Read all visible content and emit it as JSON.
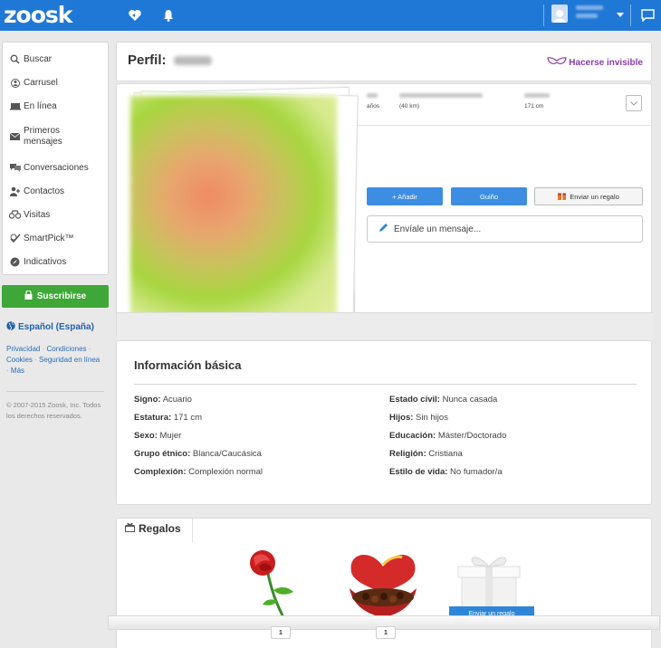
{
  "brand": {
    "logo": "zoosk"
  },
  "header": {
    "icons": [
      "heart-icon",
      "bell-icon",
      "avatar-icon",
      "chevron-down-icon",
      "chat-icon"
    ]
  },
  "sidebar": {
    "items": [
      {
        "label": "Buscar",
        "icon": "search-icon"
      },
      {
        "label": "Carrusel",
        "icon": "carousel-icon"
      },
      {
        "label": "En línea",
        "icon": "online-icon"
      },
      {
        "label": "Primeros mensajes",
        "icon": "envelope-icon"
      },
      {
        "label": "Conversaciones",
        "icon": "conversations-icon"
      },
      {
        "label": "Contactos",
        "icon": "contacts-icon"
      },
      {
        "label": "Visitas",
        "icon": "binoculars-icon"
      },
      {
        "label": "SmartPick™",
        "icon": "smartpick-icon"
      },
      {
        "label": "Indicativos",
        "icon": "compass-icon"
      }
    ],
    "subscribe": "Suscribirse",
    "language": "Español (España)",
    "links": [
      "Privacidad",
      "Condiciones",
      "Cookies",
      "Seguridad en línea",
      "Más"
    ],
    "copyright": "© 2007-2015 Zoosk, Inc. Todos los derechos reservados."
  },
  "profile": {
    "title": "Perfil:",
    "invisible": "Hacerse invisible",
    "stats": {
      "age_unit": "años",
      "distance": "(40 km)",
      "height": "171 cm"
    },
    "buttons": {
      "add": "+ Añadir",
      "wink": "Guiño",
      "gift": "Enviar un regalo"
    },
    "message_placeholder": "Envíale un mensaje..."
  },
  "basic_info": {
    "heading": "Información básica",
    "left": [
      {
        "label": "Signo:",
        "value": "Acuario"
      },
      {
        "label": "Estatura:",
        "value": "171 cm"
      },
      {
        "label": "Sexo:",
        "value": "Mujer"
      },
      {
        "label": "Grupo étnico:",
        "value": "Blanca/Caucásica"
      },
      {
        "label": "Complexión:",
        "value": "Complexión normal"
      }
    ],
    "right": [
      {
        "label": "Estado civil:",
        "value": "Nunca casada"
      },
      {
        "label": "Hijos:",
        "value": "Sin hijos"
      },
      {
        "label": "Educación:",
        "value": "Máster/Doctorado"
      },
      {
        "label": "Religión:",
        "value": "Cristiana"
      },
      {
        "label": "Estilo de vida:",
        "value": "No fumador/a"
      }
    ]
  },
  "gifts": {
    "title": "Regalos",
    "counts": [
      "1",
      "1"
    ],
    "send_label": "Enviar un regalo"
  },
  "colors": {
    "brand_blue": "#1f78d6",
    "subscribe_green": "#3ea738",
    "invisible_purple": "#8a3ba8"
  }
}
